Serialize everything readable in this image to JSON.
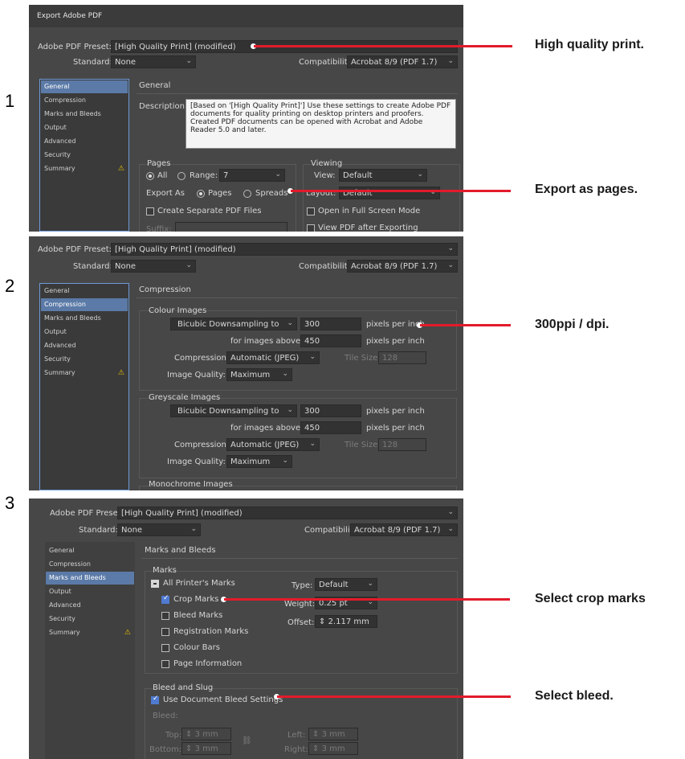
{
  "steps": [
    "1",
    "2",
    "3"
  ],
  "annotations": {
    "a1": "High quality print.",
    "a2": "Export as pages.",
    "a3": "300ppi / dpi.",
    "a4": "Select crop marks",
    "a5": "Select bleed."
  },
  "colors": {
    "callout": "#e21b2b",
    "selected": "#5b7aa7",
    "panel": "#474747"
  },
  "common": {
    "window_title": "Export Adobe PDF",
    "preset_label": "Adobe PDF Preset:",
    "preset_value": "[High Quality Print] (modified)",
    "standard_label": "Standard:",
    "standard_value": "None",
    "compat_label": "Compatibility:",
    "compat_value": "Acrobat 8/9 (PDF 1.7)",
    "sidebar": [
      "General",
      "Compression",
      "Marks and Bleeds",
      "Output",
      "Advanced",
      "Security",
      "Summary"
    ],
    "warning_icon": "warning-icon"
  },
  "p1": {
    "section": "General",
    "desc_label": "Description:",
    "desc_lines": [
      "[Based on '[High Quality Print]'] Use these settings to create Adobe PDF",
      "documents for quality printing on desktop printers and proofers.",
      "Created PDF documents can be opened with Acrobat and Adobe",
      "Reader 5.0 and later."
    ],
    "pages_title": "Pages",
    "all": "All",
    "range": "Range:",
    "range_value": "7",
    "export_as": "Export As",
    "pages_opt": "Pages",
    "spreads_opt": "Spreads",
    "create_sep": "Create Separate PDF Files",
    "suffix": "Suffix:",
    "viewing_title": "Viewing",
    "view_label": "View:",
    "view_value": "Default",
    "layout_label": "Layout:",
    "layout_value": "Default",
    "open_full": "Open in Full Screen Mode",
    "view_after": "View PDF after Exporting"
  },
  "p2": {
    "section": "Compression",
    "colour_title": "Colour Images",
    "greyscale_title": "Greyscale Images",
    "mono_title": "Monochrome Images",
    "downsample": "Bicubic Downsampling to",
    "ppi": "300",
    "ppi_unit": "pixels per inch",
    "above_label": "for images above:",
    "above_value": "450",
    "compression_label": "Compression:",
    "compression_value": "Automatic (JPEG)",
    "tile_label": "Tile Size:",
    "tile_value": "128",
    "quality_label": "Image Quality:",
    "quality_value": "Maximum"
  },
  "p3": {
    "section": "Marks and Bleeds",
    "marks_title": "Marks",
    "all_marks": "All Printer's Marks",
    "crop": "Crop Marks",
    "bleed_marks": "Bleed Marks",
    "reg": "Registration Marks",
    "colour_bars": "Colour Bars",
    "page_info": "Page Information",
    "type_label": "Type:",
    "type_value": "Default",
    "weight_label": "Weight:",
    "weight_value": "0.25 pt",
    "offset_label": "Offset:",
    "offset_value": "2.117 mm",
    "bleed_title": "Bleed and Slug",
    "use_doc_bleed": "Use Document Bleed Settings",
    "bleed_label": "Bleed:",
    "top_label": "Top:",
    "bottom_label": "Bottom:",
    "left_label": "Left:",
    "right_label": "Right:",
    "bleed_val": "3 mm"
  }
}
